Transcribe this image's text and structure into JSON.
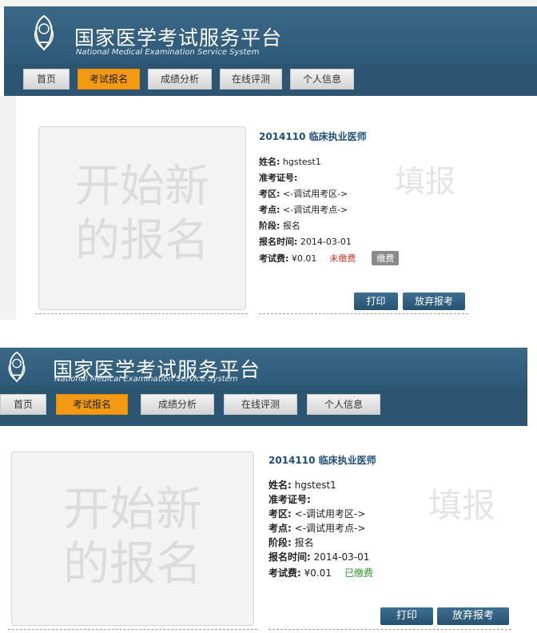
{
  "site": {
    "title_cn": "国家医学考试服务平台",
    "title_en": "National Medical Examination Service System"
  },
  "nav": {
    "items": [
      "首页",
      "考试报名",
      "成绩分析",
      "在线评测",
      "个人信息"
    ],
    "active": "考试报名"
  },
  "new_registration": {
    "line1": "开始新",
    "line2": "的报名"
  },
  "watermark": "填报",
  "labels": {
    "name": "姓名:",
    "ticket": "准考证号:",
    "area": "考区:",
    "site": "考点:",
    "stage": "阶段:",
    "reg_time": "报名时间:",
    "fee": "考试费:"
  },
  "panels": [
    {
      "exam_title": "2014110 临床执业医师",
      "name": "hgstest1",
      "ticket": "",
      "area": "<-调试用考区->",
      "site": "<-调试用考点->",
      "stage": "报名",
      "reg_time": "2014-03-01",
      "fee": "¥0.01",
      "fee_status": "未缴费",
      "pay_button": "缴费",
      "print_button": "打印",
      "abandon_button": "放弃报考"
    },
    {
      "exam_title": "2014110 临床执业医师",
      "name": "hgstest1",
      "ticket": "",
      "area": "<-调试用考区->",
      "site": "<-调试用考点->",
      "stage": "报名",
      "reg_time": "2014-03-01",
      "fee": "¥0.01",
      "fee_status": "已缴费",
      "print_button": "打印",
      "abandon_button": "放弃报考"
    }
  ],
  "colors": {
    "header": "#2e5a78",
    "active_tab": "#f49a12",
    "unpaid": "#c0392b",
    "paid": "#2e9b2e"
  }
}
